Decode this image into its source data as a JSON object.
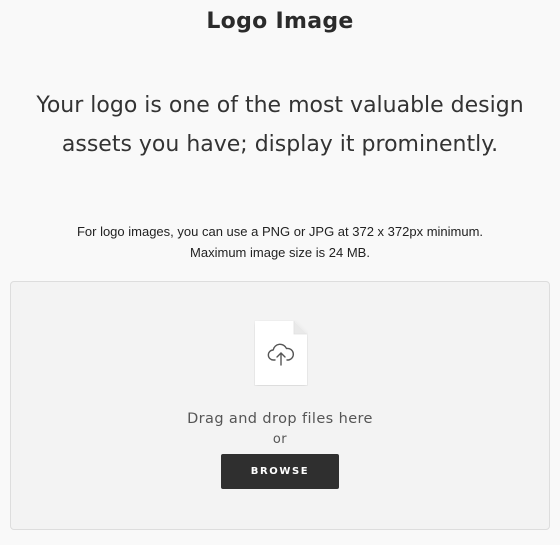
{
  "page": {
    "title": "Logo Image",
    "headline": "Your logo is one of the most valuable design assets you have; display it prominently.",
    "requirements": {
      "line1": "For logo images, you can use a PNG or JPG at 372 x 372px minimum.",
      "line2": "Maximum image size is 24 MB."
    }
  },
  "dropzone": {
    "icon": "cloud-upload-icon",
    "drag_text": "Drag and drop files here",
    "or_text": "or",
    "browse_label": "BROWSE"
  },
  "colors": {
    "background": "#f9f9f9",
    "dropzone_bg": "#f3f3f3",
    "button_bg": "#2f2f2f",
    "button_text": "#ffffff"
  }
}
